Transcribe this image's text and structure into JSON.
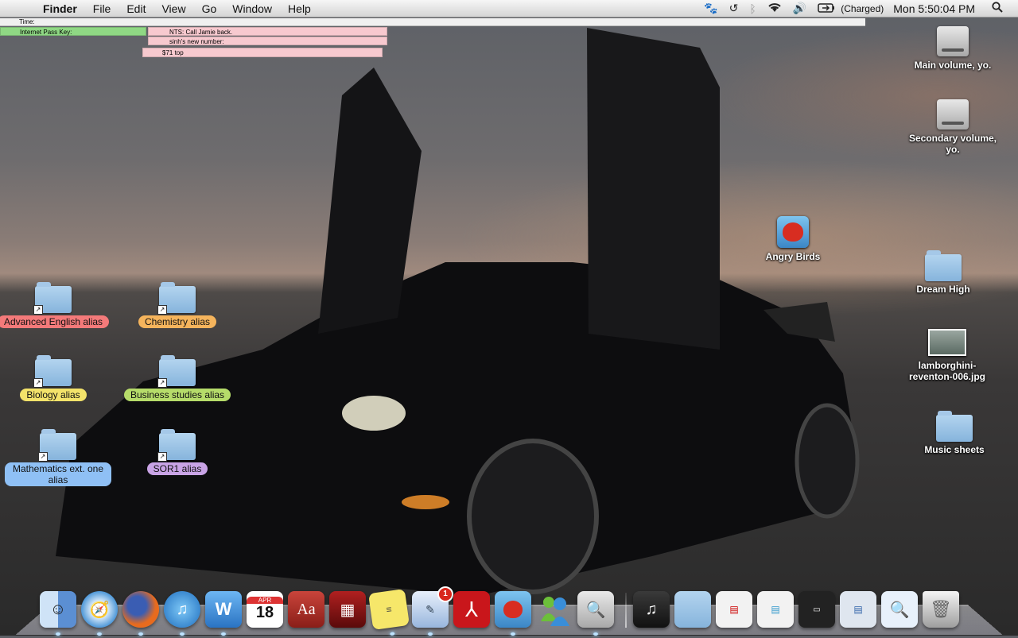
{
  "menubar": {
    "apple_glyph": "",
    "app_name": "Finder",
    "menus": [
      "File",
      "Edit",
      "View",
      "Go",
      "Window",
      "Help"
    ],
    "battery_text": "(Charged)",
    "clock": "Mon 5:50:04 PM"
  },
  "notes": {
    "time_label": "Time:",
    "internet_pass_key": "Internet Pass Key:",
    "nts": "NTS: Call Jamie back.",
    "sinh": "sinh's new number:",
    "top": "$71 top"
  },
  "desktop": {
    "left_icons": [
      {
        "label": "Advanced English alias",
        "color": "#f47a7a"
      },
      {
        "label": "Chemistry alias",
        "color": "#f5b45c"
      },
      {
        "label": "Biology alias",
        "color": "#f3e36a"
      },
      {
        "label": "Business studies alias",
        "color": "#b6dc6a"
      },
      {
        "label": "Mathematics ext. one alias",
        "color": "#8fc0f5"
      },
      {
        "label": "SOR1 alias",
        "color": "#c9a4e6"
      }
    ],
    "right_icons": [
      {
        "label": "Main volume, yo."
      },
      {
        "label": "Secondary volume, yo."
      },
      {
        "label": "Angry Birds"
      },
      {
        "label": "Dream High"
      },
      {
        "label": "lamborghini-reventon-006.jpg"
      },
      {
        "label": "Music sheets"
      }
    ]
  },
  "dock": {
    "calendar_month": "APR",
    "calendar_day": "18",
    "dictionary_text": "Aa",
    "mail_badge": "1"
  }
}
